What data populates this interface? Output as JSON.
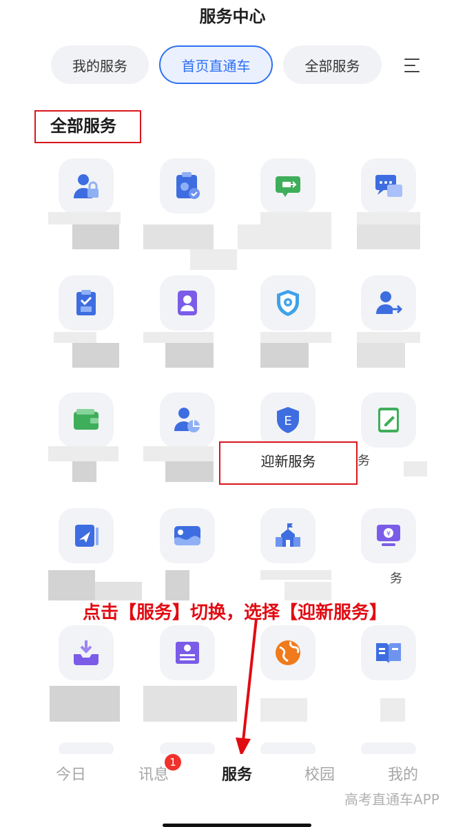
{
  "header": {
    "title": "服务中心"
  },
  "tabs": [
    {
      "label": "我的服务",
      "active": false
    },
    {
      "label": "首页直通车",
      "active": true
    },
    {
      "label": "全部服务",
      "active": false
    }
  ],
  "section": {
    "title": "全部服务"
  },
  "highlight": {
    "label": "迎新服务"
  },
  "partial_labels": [
    "务",
    "务"
  ],
  "annotation": {
    "text": "点击【服务】切换，选择【迎新服务】"
  },
  "bottom_nav": {
    "items": [
      "今日",
      "讯息",
      "服务",
      "校园",
      "我的"
    ],
    "active": "服务",
    "badge_count": "1"
  },
  "watermark": "高考直通车APP",
  "colors": {
    "accent_blue": "#2d6ff3",
    "annotation_red": "#e10b12",
    "badge_red": "#f0312c"
  },
  "icons": [
    "user-lock-icon",
    "passport-calendar-icon",
    "screen-share-icon",
    "chat-bubbles-icon",
    "clipboard-check-icon",
    "id-card-icon",
    "shield-gear-icon",
    "user-transfer-icon",
    "wallet-icon",
    "user-chart-icon",
    "e-badge-icon",
    "notebook-edit-icon",
    "send-document-icon",
    "card-wave-icon",
    "school-building-icon",
    "yuan-monitor-icon",
    "download-tray-icon",
    "certificate-icon",
    "globe-icon",
    "open-book-icon"
  ]
}
